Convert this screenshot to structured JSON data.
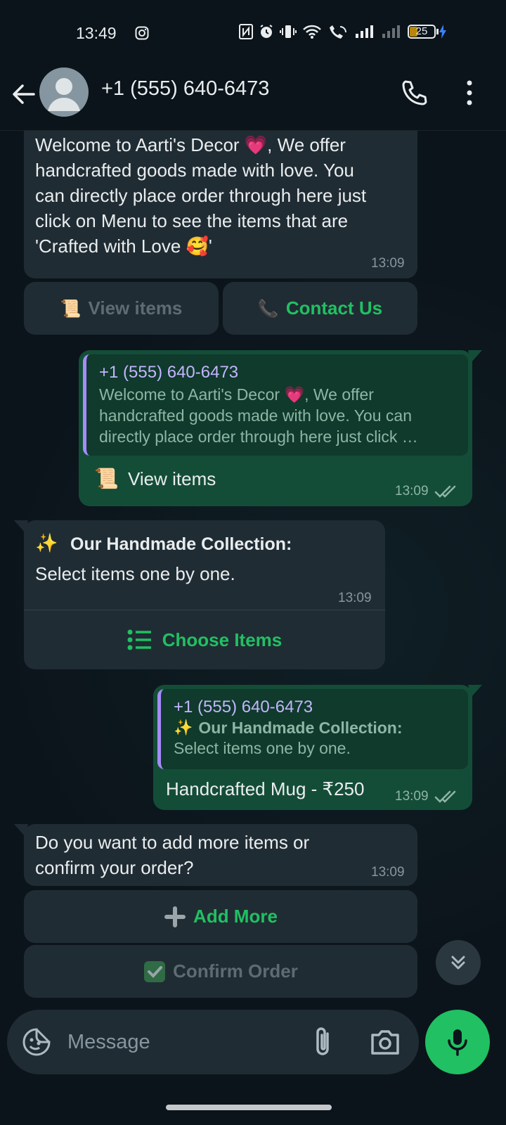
{
  "status": {
    "time": "13:49",
    "battery": "25"
  },
  "header": {
    "contact": "+1 (555) 640-6473"
  },
  "messages": {
    "m1": {
      "line1": "Welcome to Aarti's Decor 💗, We offer",
      "line2": "handcrafted goods made with love. You",
      "line3": "can directly place order through here just",
      "line4": "click on Menu to see the items that are",
      "line5": "'Crafted with Love 🥰'",
      "time": "13:09",
      "btn_view": "View items",
      "btn_contact": "Contact Us"
    },
    "m2": {
      "quote_name": "+1 (555) 640-6473",
      "quote_line1": "Welcome to Aarti's Decor 💗, We offer",
      "quote_line2": "handcrafted goods made with love. You can",
      "quote_line3": "directly place order through here just click …",
      "text": "View items",
      "time": "13:09"
    },
    "m3": {
      "title": "Our Handmade Collection:",
      "body": "Select items one by one.",
      "time": "13:09",
      "btn_choose": "Choose Items"
    },
    "m4": {
      "quote_name": "+1 (555) 640-6473",
      "quote_title": "Our Handmade Collection:",
      "quote_body": "Select items one by one.",
      "text": "Handcrafted Mug - ₹250",
      "time": "13:09"
    },
    "m5": {
      "line1": "Do you want to add more items or",
      "line2": "confirm your order?",
      "time": "13:09",
      "btn_add": "Add More",
      "btn_confirm": "Confirm Order"
    }
  },
  "composer": {
    "placeholder": "Message"
  },
  "colors": {
    "background": "#0b141a",
    "incoming_bubble": "#202c33",
    "outgoing_bubble": "#144d37",
    "accent_green": "#21c063",
    "quote_bar": "#a78bfa"
  }
}
